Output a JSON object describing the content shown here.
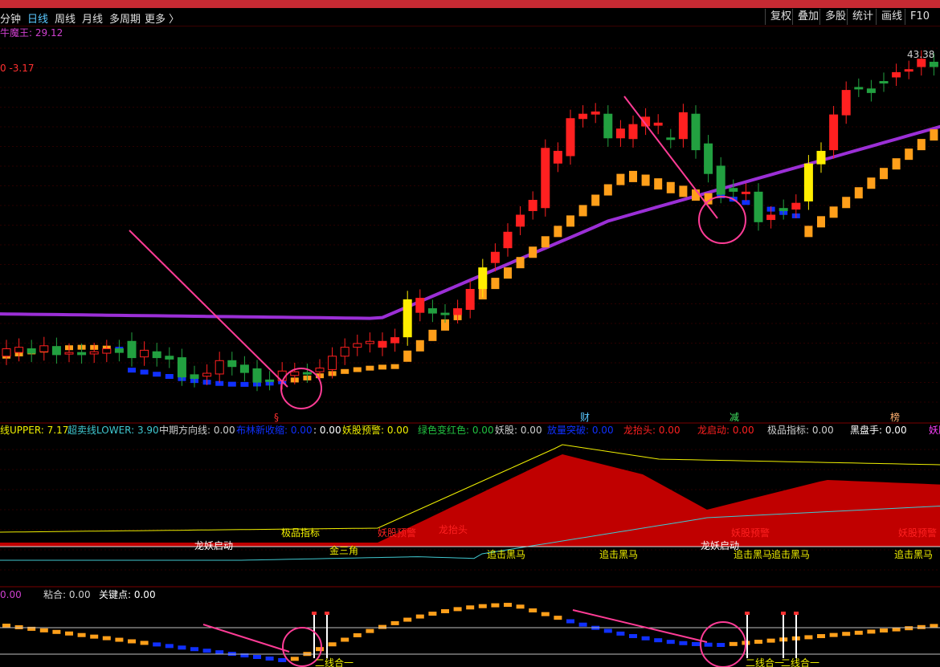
{
  "toolbar": {
    "tabs": [
      "分钟",
      "日线",
      "周线",
      "月线",
      "多周期",
      "更多 〉"
    ],
    "active_tab": "日线",
    "right_buttons": [
      "复权",
      "叠加",
      "多股",
      "统计",
      "画线",
      "F10"
    ]
  },
  "colors": {
    "up": "#ff2020",
    "down": "#22a040",
    "highlight": "#ffee00",
    "ma_line": "#9b2fd6",
    "step_up": "#ff9f1a",
    "step_down": "#1030ff",
    "arrow": "#ff3c96",
    "band_fill": "#c00000",
    "upper_line": "#f0f000",
    "lower_line": "#40c8d0"
  },
  "main_panel": {
    "indicator_name": "牛魔王: 29.12",
    "left_value": "0 -3.17",
    "max_price_label": "43.38",
    "event_markers": [
      "§",
      "财",
      "减",
      "榜"
    ]
  },
  "middle_panel": {
    "legend": [
      {
        "label": "线UPPER: 7.17",
        "color": "#f0f000"
      },
      {
        "label": "超卖线LOWER: 3.90",
        "color": "#40c8d0"
      },
      {
        "label": "中期方向线: 0.00",
        "color": "#d0d0d0"
      },
      {
        "label": "布林新收缩: 0.00",
        "color": "#1030ff"
      },
      {
        "label": ": 0.00",
        "color": "#ffffff"
      },
      {
        "label": "妖股预警: 0.00",
        "color": "#f0f000"
      },
      {
        "label": "绿色变红色: 0.00",
        "color": "#22c040"
      },
      {
        "label": "妖股: 0.00",
        "color": "#d0d0d0"
      },
      {
        "label": "放量突破: 0.00",
        "color": "#1030ff"
      },
      {
        "label": "龙抬头: 0.00",
        "color": "#ff2020"
      },
      {
        "label": "龙启动: 0.00",
        "color": "#ff2020"
      },
      {
        "label": "极品指标: 0.00",
        "color": "#d0d0d0"
      },
      {
        "label": "黑盘手: 0.00",
        "color": "#ffffff"
      },
      {
        "label": "妖股",
        "color": "#ff40ff"
      }
    ],
    "annotations": [
      {
        "text": "龙妖启动",
        "color": "#ffffff"
      },
      {
        "text": "极品指标",
        "color": "#f0f000"
      },
      {
        "text": "金三角",
        "color": "#f0f000"
      },
      {
        "text": "妖股预警",
        "color": "#ff2020"
      },
      {
        "text": "龙抬头",
        "color": "#ff2020"
      },
      {
        "text": "追击黑马",
        "color": "#f0f000"
      },
      {
        "text": "追击黑马",
        "color": "#f0f000"
      },
      {
        "text": "龙妖启动",
        "color": "#ffffff"
      },
      {
        "text": "妖股预警",
        "color": "#ff2020"
      },
      {
        "text": "追击黑马",
        "color": "#f0f000"
      },
      {
        "text": "追击黑马",
        "color": "#f0f000"
      },
      {
        "text": "妖股预警",
        "color": "#ff2020"
      },
      {
        "text": "追击黑马",
        "color": "#f0f000"
      }
    ]
  },
  "bottom_panel": {
    "legend": [
      {
        "label": "0.00",
        "color": "#d040d0"
      },
      {
        "label": "粘合: 0.00",
        "color": "#d0d0d0"
      },
      {
        "label": "关键点: 0.00",
        "color": "#ffffff"
      }
    ],
    "annotations": [
      {
        "text": "二线合一",
        "color": "#f0f000"
      },
      {
        "text": "二线合一",
        "color": "#f0f000"
      },
      {
        "text": "二线合一",
        "color": "#f0f000"
      }
    ]
  },
  "chart_data": {
    "type": "candlestick",
    "y_top_label": "43.38",
    "candles": [
      {
        "o": 5.0,
        "c": 6.0
      },
      {
        "o": 5.5,
        "c": 6.2
      },
      {
        "o": 6.0,
        "c": 5.4
      },
      {
        "o": 5.6,
        "c": 6.4
      },
      {
        "o": 6.3,
        "c": 5.2
      },
      {
        "o": 5.4,
        "c": 5.5
      },
      {
        "o": 5.5,
        "c": 5.2
      },
      {
        "o": 5.3,
        "c": 5.6
      },
      {
        "o": 5.4,
        "c": 6.0
      },
      {
        "o": 6.0,
        "c": 5.5
      },
      {
        "o": 7.0,
        "c": 4.8
      },
      {
        "o": 4.9,
        "c": 5.8
      },
      {
        "o": 5.6,
        "c": 4.8
      },
      {
        "o": 5.0,
        "c": 4.6
      },
      {
        "o": 4.8,
        "c": 2.2
      },
      {
        "o": 2.5,
        "c": 2.0
      },
      {
        "o": 2.3,
        "c": 2.7
      },
      {
        "o": 2.6,
        "c": 4.4
      },
      {
        "o": 4.4,
        "c": 3.6
      },
      {
        "o": 3.8,
        "c": 2.8
      },
      {
        "o": 3.3,
        "c": 1.5
      },
      {
        "o": 1.8,
        "c": 1.6
      },
      {
        "o": 1.7,
        "c": 3.0
      },
      {
        "o": 2.4,
        "c": 2.9
      },
      {
        "o": 2.8,
        "c": 2.6
      },
      {
        "o": 2.9,
        "c": 3.4
      },
      {
        "o": 3.2,
        "c": 5.0
      },
      {
        "o": 5.0,
        "c": 6.2
      },
      {
        "o": 6.2,
        "c": 6.7
      },
      {
        "o": 6.7,
        "c": 7.0
      },
      {
        "o": 6.2,
        "c": 7.0
      },
      {
        "o": 6.8,
        "c": 7.5
      },
      {
        "o": 7.6,
        "c": 12.6
      },
      {
        "o": 10.9,
        "c": 12.8
      },
      {
        "o": 11.4,
        "c": 10.8
      },
      {
        "o": 10.8,
        "c": 10.7
      },
      {
        "o": 10.6,
        "c": 11.4
      },
      {
        "o": 11.3,
        "c": 14.0
      },
      {
        "o": 14.1,
        "c": 16.9
      },
      {
        "o": 17.6,
        "c": 19.0
      },
      {
        "o": 19.6,
        "c": 21.7
      },
      {
        "o": 22.5,
        "c": 24.0
      },
      {
        "o": 24.6,
        "c": 26.0
      },
      {
        "o": 25.0,
        "c": 33.0
      },
      {
        "o": 31.0,
        "c": 32.6
      },
      {
        "o": 32.0,
        "c": 37.0
      },
      {
        "o": 37.0,
        "c": 37.6
      },
      {
        "o": 37.6,
        "c": 37.9
      },
      {
        "o": 37.6,
        "c": 34.4
      },
      {
        "o": 34.4,
        "c": 35.6
      },
      {
        "o": 34.3,
        "c": 36.2
      },
      {
        "o": 36.0,
        "c": 37.2
      },
      {
        "o": 36.1,
        "c": 36.4
      },
      {
        "o": 34.4,
        "c": 34.2
      },
      {
        "o": 34.3,
        "c": 37.8
      },
      {
        "o": 37.6,
        "c": 32.8
      },
      {
        "o": 33.6,
        "c": 29.6
      },
      {
        "o": 30.6,
        "c": 26.8
      },
      {
        "o": 27.6,
        "c": 27.2
      },
      {
        "o": 27.1,
        "c": 27.1
      },
      {
        "o": 27.1,
        "c": 23.1
      },
      {
        "o": 23.4,
        "c": 24.0
      },
      {
        "o": 24.9,
        "c": 24.6
      },
      {
        "o": 24.8,
        "c": 25.6
      },
      {
        "o": 25.9,
        "c": 30.9
      },
      {
        "o": 30.9,
        "c": 32.6
      },
      {
        "o": 32.8,
        "c": 37.5
      },
      {
        "o": 37.5,
        "c": 40.8
      },
      {
        "o": 41.2,
        "c": 41.1
      },
      {
        "o": 41.0,
        "c": 40.5
      },
      {
        "o": 42.0,
        "c": 41.8
      },
      {
        "o": 42.6,
        "c": 43.2
      },
      {
        "o": 43.5,
        "c": 43.6
      },
      {
        "o": 44.0,
        "c": 45.0
      },
      {
        "o": 44.6,
        "c": 44.0
      },
      {
        "o": 45.3,
        "c": 44.6
      },
      {
        "o": 44.6,
        "c": 42.0
      },
      {
        "o": 42.8,
        "c": 40.6
      },
      {
        "o": 40.2,
        "c": 40.0
      },
      {
        "o": 39.6,
        "c": 40.8
      },
      {
        "o": 40.8,
        "c": 42.6
      },
      {
        "o": 41.4,
        "c": 41.0
      },
      {
        "o": 41.0,
        "c": 41.6
      },
      {
        "o": 42.7,
        "c": 49.8
      },
      {
        "o": 49.8,
        "c": 45.6
      },
      {
        "o": 46.0,
        "c": 45.0
      },
      {
        "o": 44.5,
        "c": 42.5
      }
    ]
  }
}
